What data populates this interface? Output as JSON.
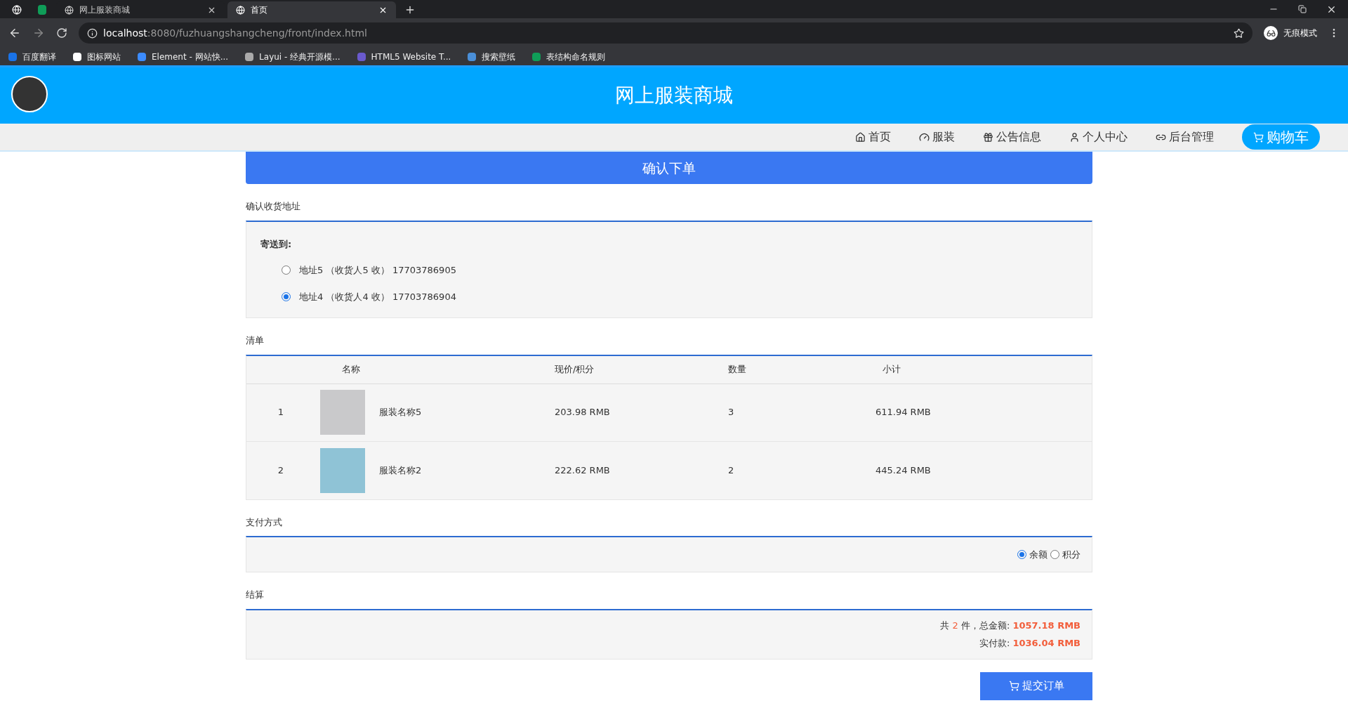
{
  "browser": {
    "tabs": [
      {
        "kind": "pinned",
        "selected": false
      },
      {
        "kind": "pinned-sheet",
        "selected": false
      },
      {
        "kind": "page",
        "label": "网上服装商城",
        "selected": false
      },
      {
        "kind": "page",
        "label": "首页",
        "selected": true
      }
    ],
    "url_host": "localhost",
    "url_rest": ":8080/fuzhuangshangcheng/front/index.html",
    "incognito": "无痕模式",
    "bookmarks": [
      "百度翻译",
      "图标网站",
      "Element - 网站快...",
      "Layui - 经典开源模...",
      "HTML5 Website T...",
      "搜索壁纸",
      "表结构命名规则"
    ]
  },
  "site": {
    "title": "网上服装商城"
  },
  "nav": [
    {
      "label": "首页",
      "kind": "home",
      "selected": false
    },
    {
      "label": "服装",
      "kind": "gauge",
      "selected": false
    },
    {
      "label": "公告信息",
      "kind": "gift",
      "selected": false
    },
    {
      "label": "个人中心",
      "kind": "user",
      "selected": false
    },
    {
      "label": "后台管理",
      "kind": "link",
      "selected": false
    },
    {
      "label": "购物车",
      "kind": "cart",
      "selected": true
    }
  ],
  "confirm_title": "确认下单",
  "address": {
    "heading": "确认收货地址",
    "label": "寄送到:",
    "options": [
      {
        "text": "地址5 （收货人5 收） 17703786905",
        "selected": false
      },
      {
        "text": "地址4 （收货人4 收） 17703786904",
        "selected": true
      }
    ]
  },
  "list": {
    "heading": "清单",
    "columns": [
      "名称",
      "现价/积分",
      "数量",
      "小计"
    ],
    "rows": [
      {
        "index": "1",
        "name": "服装名称5",
        "price": "203.98 RMB",
        "qty": "3",
        "subtotal": "611.94 RMB"
      },
      {
        "index": "2",
        "name": "服装名称2",
        "price": "222.62 RMB",
        "qty": "2",
        "subtotal": "445.24 RMB"
      }
    ]
  },
  "payment": {
    "heading": "支付方式",
    "options": [
      {
        "label": "余额",
        "selected": true
      },
      {
        "label": "积分",
        "selected": false
      }
    ]
  },
  "settle": {
    "heading": "结算",
    "count_prefix": "共",
    "count": "2",
    "count_suffix": "件，总金额:",
    "total": "1057.18 RMB",
    "paid_label": "实付款:",
    "paid": "1036.04 RMB"
  },
  "submit": "提交订单"
}
